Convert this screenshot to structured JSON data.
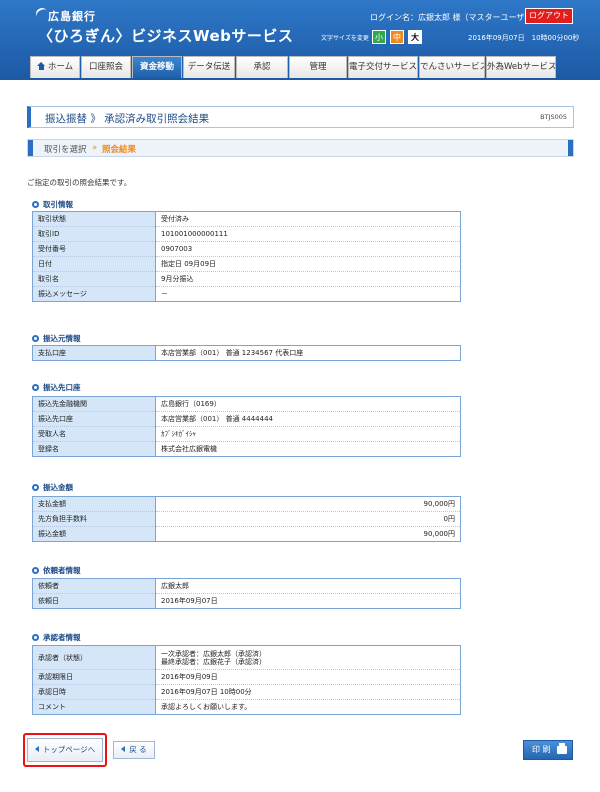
{
  "header": {
    "bank_name": "広島銀行",
    "service_name": "〈ひろぎん〉ビジネスWebサービス",
    "login_name": "ログイン名：広銀太郎 様（マスターユーザ）",
    "logout_label": "ログアウト",
    "font_size_label": "文字サイズを変更",
    "font_small": "小",
    "font_medium": "中",
    "font_large": "大",
    "datetime": "2016年09月07日　10時00分00秒"
  },
  "nav": {
    "items": [
      "ホーム",
      "口座照会",
      "資金移動",
      "データ伝送",
      "承認",
      "管理",
      "電子交付サービス",
      "でんさいサービス",
      "外為Webサービス"
    ]
  },
  "page": {
    "title": "振込振替 》 承認済み取引照会結果",
    "code": "BTJS005",
    "step1": "取引を選択",
    "step_arrow": "»",
    "step2": "照会結果",
    "intro": "ご指定の取引の照会結果です。"
  },
  "sections": {
    "transaction": {
      "title": "取引情報",
      "rows": [
        {
          "label": "取引状態",
          "value": "受付済み"
        },
        {
          "label": "取引ID",
          "value": "101001000000111"
        },
        {
          "label": "受付番号",
          "value": "0907003"
        },
        {
          "label": "日付",
          "value": "指定日 09月09日"
        },
        {
          "label": "取引名",
          "value": "9月分振込"
        },
        {
          "label": "振込メッセージ",
          "value": "－"
        }
      ]
    },
    "source": {
      "title": "振込元情報",
      "rows": [
        {
          "label": "支払口座",
          "value": "本店営業部（001） 普通 1234567 代表口座"
        }
      ]
    },
    "destination": {
      "title": "振込先口座",
      "rows": [
        {
          "label": "振込先金融機関",
          "value": "広島銀行（0169）"
        },
        {
          "label": "振込先口座",
          "value": "本店営業部（001） 普通 4444444"
        },
        {
          "label": "受取人名",
          "value": "ｶﾌﾞｼｷｶﾞｲｼｬ"
        },
        {
          "label": "登録名",
          "value": "株式会社広銀電機"
        }
      ]
    },
    "amount": {
      "title": "振込金額",
      "rows": [
        {
          "label": "支払金額",
          "value": "90,000円"
        },
        {
          "label": "先方負担手数料",
          "value": "0円"
        },
        {
          "label": "振込金額",
          "value": "90,000円"
        }
      ]
    },
    "requester": {
      "title": "依頼者情報",
      "rows": [
        {
          "label": "依頼者",
          "value": "広銀太郎"
        },
        {
          "label": "依頼日",
          "value": "2016年09月07日"
        }
      ]
    },
    "approver": {
      "title": "承認者情報",
      "rows": [
        {
          "label": "承認者（状態）",
          "value": "一次承認者：広銀太郎（承認済）",
          "value2": "最終承認者：広銀花子（承認済）"
        },
        {
          "label": "承認期限日",
          "value": "2016年09月09日"
        },
        {
          "label": "承認日時",
          "value": "2016年09月07日 10時00分"
        },
        {
          "label": "コメント",
          "value": "承認よろしくお願いします。"
        }
      ]
    }
  },
  "buttons": {
    "top_page": "トップページへ",
    "back": "戻 る",
    "print": "印 刷"
  },
  "colors": {
    "header_blue": "#1c5aa6",
    "label_bg": "#d4e6f8",
    "logout_red": "#e31c1c",
    "highlight_frame": "#e11111",
    "step_orange": "#f08a1c"
  }
}
